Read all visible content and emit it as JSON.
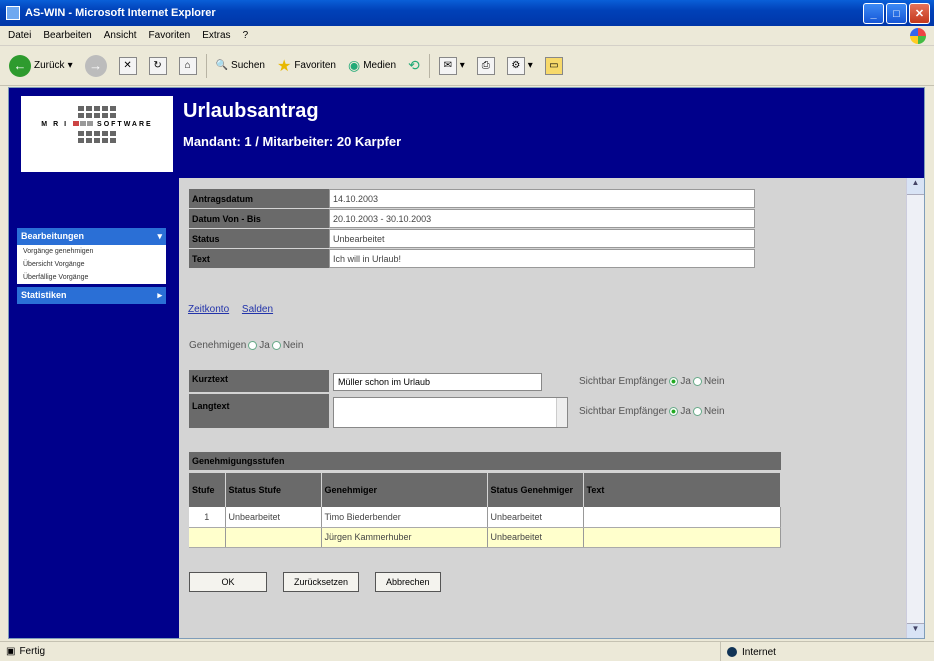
{
  "window": {
    "title": "AS-WIN - Microsoft Internet Explorer"
  },
  "menu": [
    "Datei",
    "Bearbeiten",
    "Ansicht",
    "Favoriten",
    "Extras",
    "?"
  ],
  "toolbar": {
    "back": "Zurück",
    "search": "Suchen",
    "favorites": "Favoriten",
    "media": "Medien"
  },
  "logo": {
    "left_text": "M R I",
    "right_text": "SOFTWARE"
  },
  "header": {
    "title": "Urlaubsantrag",
    "subtitle": "Mandant: 1 / Mitarbeiter: 20 Karpfer"
  },
  "sidebar": {
    "groups": [
      {
        "label": "Bearbeitungen",
        "items": [
          "Vorgänge genehmigen",
          "Übersicht Vorgänge",
          "Überfällige Vorgänge"
        ]
      },
      {
        "label": "Statistiken",
        "items": []
      }
    ]
  },
  "info": [
    {
      "label": "Antragsdatum",
      "value": "14.10.2003"
    },
    {
      "label": "Datum Von - Bis",
      "value": "20.10.2003 - 30.10.2003"
    },
    {
      "label": "Status",
      "value": "Unbearbeitet"
    },
    {
      "label": "Text",
      "value": "Ich will in Urlaub!"
    }
  ],
  "links": [
    "Zeitkonto",
    "Salden"
  ],
  "approve": {
    "label": "Genehmigen",
    "yes": "Ja",
    "no": "Nein"
  },
  "kurztext": {
    "label": "Kurztext",
    "value": "Müller schon im Urlaub"
  },
  "langtext": {
    "label": "Langtext",
    "value": ""
  },
  "visibility": {
    "label": "Sichtbar Empfänger",
    "yes": "Ja",
    "no": "Nein"
  },
  "stages": {
    "title": "Genehmigungsstufen",
    "headers": [
      "Stufe",
      "Status Stufe",
      "Genehmiger",
      "Status Genehmiger",
      "Text"
    ],
    "rows": [
      [
        "1",
        "Unbearbeitet",
        "Timo Biederbender",
        "Unbearbeitet",
        ""
      ],
      [
        "",
        "",
        "Jürgen Kammerhuber",
        "Unbearbeitet",
        ""
      ]
    ]
  },
  "buttons": {
    "ok": "OK",
    "reset": "Zurücksetzen",
    "cancel": "Abbrechen"
  },
  "status": {
    "left": "Fertig",
    "zone": "Internet"
  }
}
